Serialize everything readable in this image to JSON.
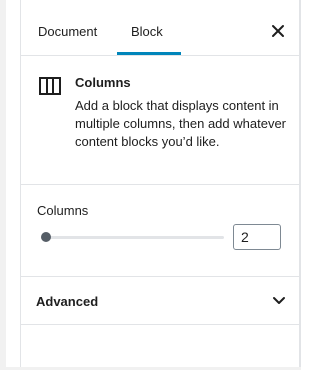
{
  "tabs": [
    {
      "label": "Document",
      "active": false
    },
    {
      "label": "Block",
      "active": true
    }
  ],
  "close_icon": "close-icon",
  "block_card": {
    "icon": "columns-icon",
    "title": "Columns",
    "description": "Add a block that displays content in multiple columns, then add whatever content blocks you’d like."
  },
  "columns_setting": {
    "label": "Columns",
    "value": "2",
    "slider_level": 0
  },
  "advanced": {
    "label": "Advanced",
    "icon": "chevron-down-icon",
    "expanded": false
  },
  "colors": {
    "accent": "#0085ba",
    "border": "#e2e4e7",
    "text": "#1e1e1e",
    "thumb": "#555d66"
  }
}
